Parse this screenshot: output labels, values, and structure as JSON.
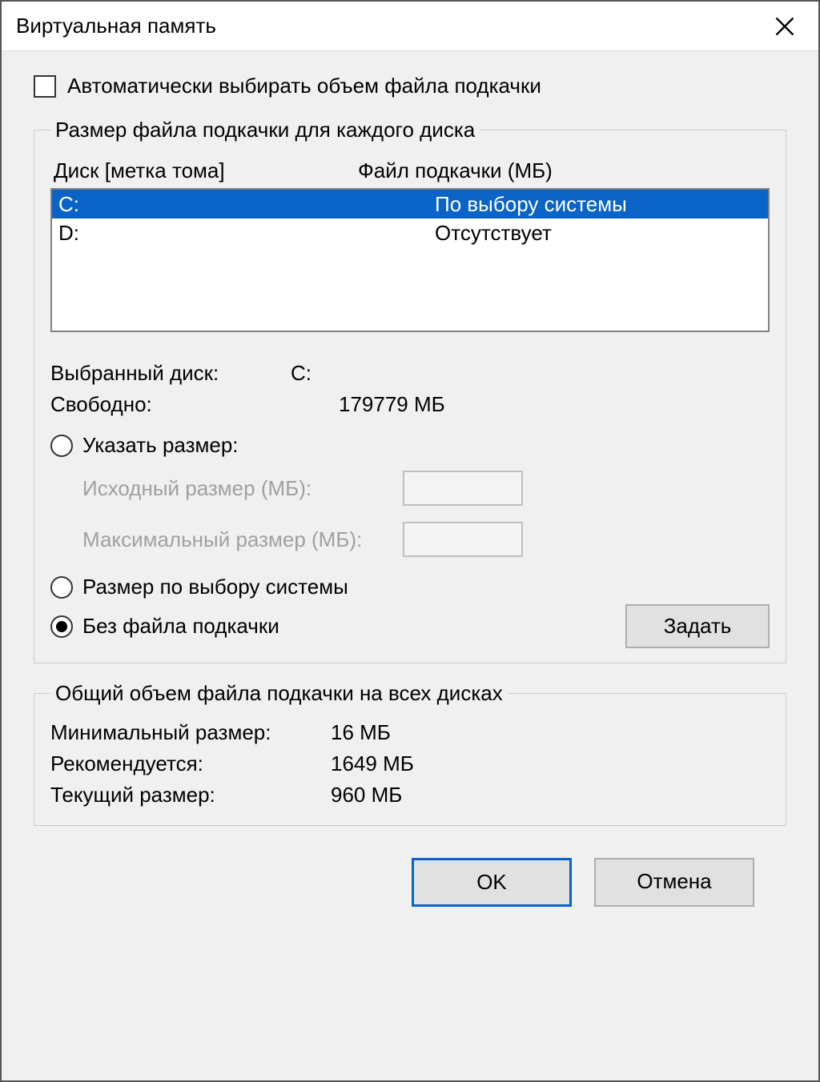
{
  "window": {
    "title": "Виртуальная память"
  },
  "auto": {
    "label": "Автоматически выбирать объем файла подкачки",
    "checked": false
  },
  "perDrive": {
    "legend": "Размер файла подкачки для каждого диска",
    "headers": {
      "drive": "Диск [метка тома]",
      "pf": "Файл подкачки (МБ)"
    },
    "rows": [
      {
        "drive": "C:",
        "pf": "По выбору системы",
        "selected": true
      },
      {
        "drive": "D:",
        "pf": "Отсутствует",
        "selected": false
      }
    ],
    "selected": {
      "driveLabel": "Выбранный диск:",
      "driveValue": "C:",
      "freeLabel": "Свободно:",
      "freeValue": "179779 МБ"
    },
    "radios": {
      "custom": "Указать размер:",
      "system": "Размер по выбору системы",
      "none": "Без файла подкачки"
    },
    "customFields": {
      "initial": "Исходный размер (МБ):",
      "max": "Максимальный размер (МБ):"
    },
    "setBtn": "Задать"
  },
  "totals": {
    "legend": "Общий объем файла подкачки на всех дисках",
    "min": {
      "label": "Минимальный размер:",
      "value": "16 МБ"
    },
    "rec": {
      "label": "Рекомендуется:",
      "value": "1649 МБ"
    },
    "cur": {
      "label": "Текущий размер:",
      "value": "960 МБ"
    }
  },
  "buttons": {
    "ok": "OK",
    "cancel": "Отмена"
  }
}
